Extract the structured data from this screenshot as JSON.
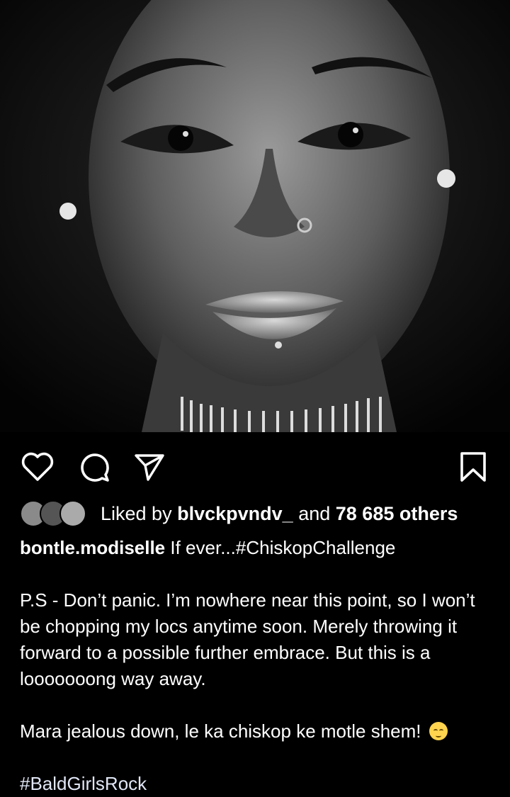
{
  "post": {
    "image": {
      "alt_icon": "portrait-photo"
    },
    "actions": {
      "like_icon": "heart-icon",
      "comment_icon": "comment-icon",
      "share_icon": "share-icon",
      "save_icon": "bookmark-icon"
    },
    "likes": {
      "prefix": "Liked by",
      "user": "blvckpvndv_",
      "joiner": "and",
      "others": "78 685 others"
    },
    "caption": {
      "username": "bontle.modiselle",
      "line1_text": "If ever...#ChiskopChallenge",
      "paragraph1": "P.S - Don’t panic. I’m nowhere near this point, so I won’t be chopping my locs anytime soon. Merely throwing it forward to a possible further embrace. But this is a looooooong way away.",
      "paragraph2": "Mara jealous down, le ka chiskop ke motle shem!",
      "hashtag": "#BaldGirlsRock"
    }
  }
}
